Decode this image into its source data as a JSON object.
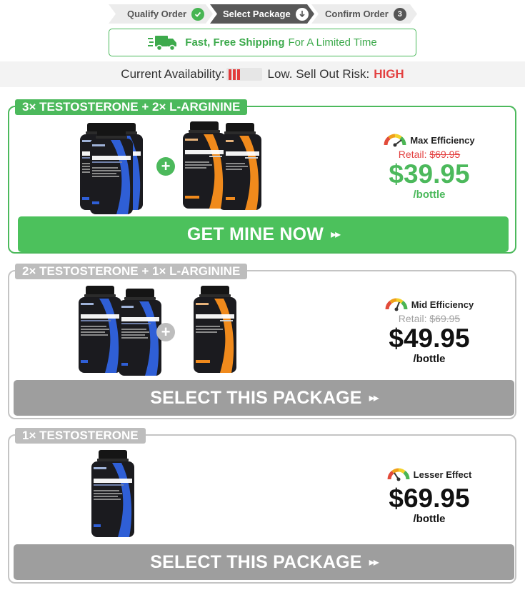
{
  "steps": [
    {
      "label": "Qualify Order",
      "status_icon": "check-icon"
    },
    {
      "label": "Select Package",
      "status_icon": "down-arrow-icon"
    },
    {
      "label": "Confirm Order",
      "number": "3"
    }
  ],
  "shipping": {
    "bold": "Fast, Free Shipping",
    "rest": "For A Limited Time",
    "icon": "truck-icon"
  },
  "availability": {
    "label": "Current Availability:",
    "low": "Low.",
    "risk_label": "Sell Out Risk:",
    "risk_value": "HIGH"
  },
  "packages": [
    {
      "title": "3× TESTOSTERONE + 2× L-ARGININE",
      "efficiency": "Max Efficiency",
      "retail_label": "Retail:",
      "retail_price": "$69.95",
      "price": "$39.95",
      "per": "/bottle",
      "cta": "GET MINE NOW",
      "cta_arrows": "▸▸",
      "gauge_level": 0.9
    },
    {
      "title": "2× TESTOSTERONE + 1× L-ARGININE",
      "efficiency": "Mid Efficiency",
      "retail_label": "Retail:",
      "retail_price": "$69.95",
      "price": "$49.95",
      "per": "/bottle",
      "cta": "SELECT THIS PACKAGE",
      "cta_arrows": "▸▸",
      "gauge_level": 0.6
    },
    {
      "title": "1× TESTOSTERONE",
      "efficiency": "Lesser Effect",
      "price": "$69.95",
      "per": "/bottle",
      "cta": "SELECT THIS PACKAGE",
      "cta_arrows": "▸▸",
      "gauge_level": 0.3
    }
  ],
  "products": {
    "testosterone": {
      "name": "TESTOSTERONE",
      "accent": "#2f5fd6"
    },
    "larginine": {
      "name": "L-ARGININE",
      "sub": "PLUS",
      "accent": "#f08a1c"
    }
  },
  "colors": {
    "green": "#4cb95c",
    "gray_button": "#9e9e9e",
    "red": "#e34141"
  }
}
